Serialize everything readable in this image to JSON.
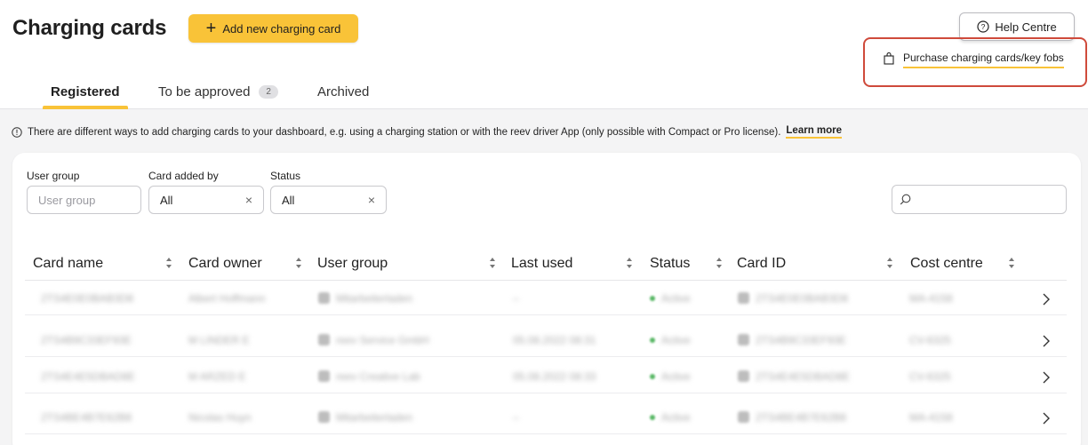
{
  "header": {
    "title": "Charging cards",
    "add_button": "Add new charging card",
    "help_button": "Help Centre",
    "purchase_link": "Purchase charging cards/key fobs"
  },
  "tabs": [
    {
      "label": "Registered",
      "active": true
    },
    {
      "label": "To be approved",
      "badge": "2"
    },
    {
      "label": "Archived"
    }
  ],
  "info": {
    "text": "There are different ways to add charging cards to your dashboard, e.g. using a charging station or with the reev driver App (only possible with Compact or Pro license).",
    "link": "Learn more"
  },
  "filters": {
    "user_group": {
      "label": "User group",
      "placeholder": "User group"
    },
    "card_added_by": {
      "label": "Card added by",
      "value": "All"
    },
    "status": {
      "label": "Status",
      "value": "All"
    }
  },
  "table": {
    "columns": [
      "Card name",
      "Card owner",
      "User group",
      "Last used",
      "Status",
      "Card ID",
      "Cost centre"
    ],
    "rows": [
      {
        "card_name": "2TS4E0E0BAB3D8",
        "owner": "Albert Hoffmann",
        "group": "Mitarbeiterladen",
        "last_used": "–",
        "status": "Active",
        "card_id": "2TS4E0E0BAB3D8",
        "cost_centre": "MA-4158"
      },
      {
        "card_name": "2TS4B9C33EF93E",
        "owner": "M LINDER E",
        "group": "reev Service GmbH",
        "last_used": "05.08.2022 08:31",
        "status": "Active",
        "card_id": "2TS4B9C33EF93E",
        "cost_centre": "CV-6325"
      },
      {
        "card_name": "2TS4E4E5DBAD8E",
        "owner": "M ARZED E",
        "group": "reev Creative Lab",
        "last_used": "05.08.2022 08:33",
        "status": "Active",
        "card_id": "2TS4E4E5DBAD8E",
        "cost_centre": "CV-6325"
      },
      {
        "card_name": "2TS4BE4B7E62B8",
        "owner": "Nicolas Huyn",
        "group": "Mitarbeiterladen",
        "last_used": "–",
        "status": "Active",
        "card_id": "2TS4BE4B7E62B8",
        "cost_centre": "MA-4158"
      }
    ]
  },
  "colors": {
    "accent": "#f9c338",
    "highlight": "#cf4a3b",
    "status_active": "#58b765"
  }
}
